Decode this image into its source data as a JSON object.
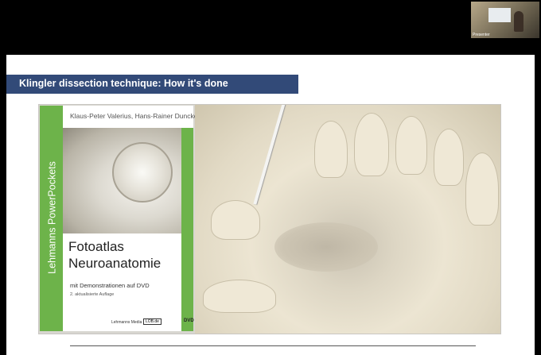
{
  "presenter": {
    "label": "Presenter"
  },
  "slide": {
    "title": "Klingler dissection technique: How it's done",
    "book": {
      "series": "Lehmanns PowerPockets",
      "authors": "Klaus-Peter Valerius, Hans-Rainer Duncker",
      "title_line1": "Fotoatlas",
      "title_line2": "Neuroanatomie",
      "subtitle": "mit Demonstrationen auf DVD",
      "edition": "2. aktualisierte Auflage",
      "publisher": "Lehmanns Media",
      "publisher_site": "LOB.de",
      "dvd_mark": "DVD"
    }
  },
  "colors": {
    "title_bar": "#324a78",
    "book_green": "#6db34a"
  }
}
